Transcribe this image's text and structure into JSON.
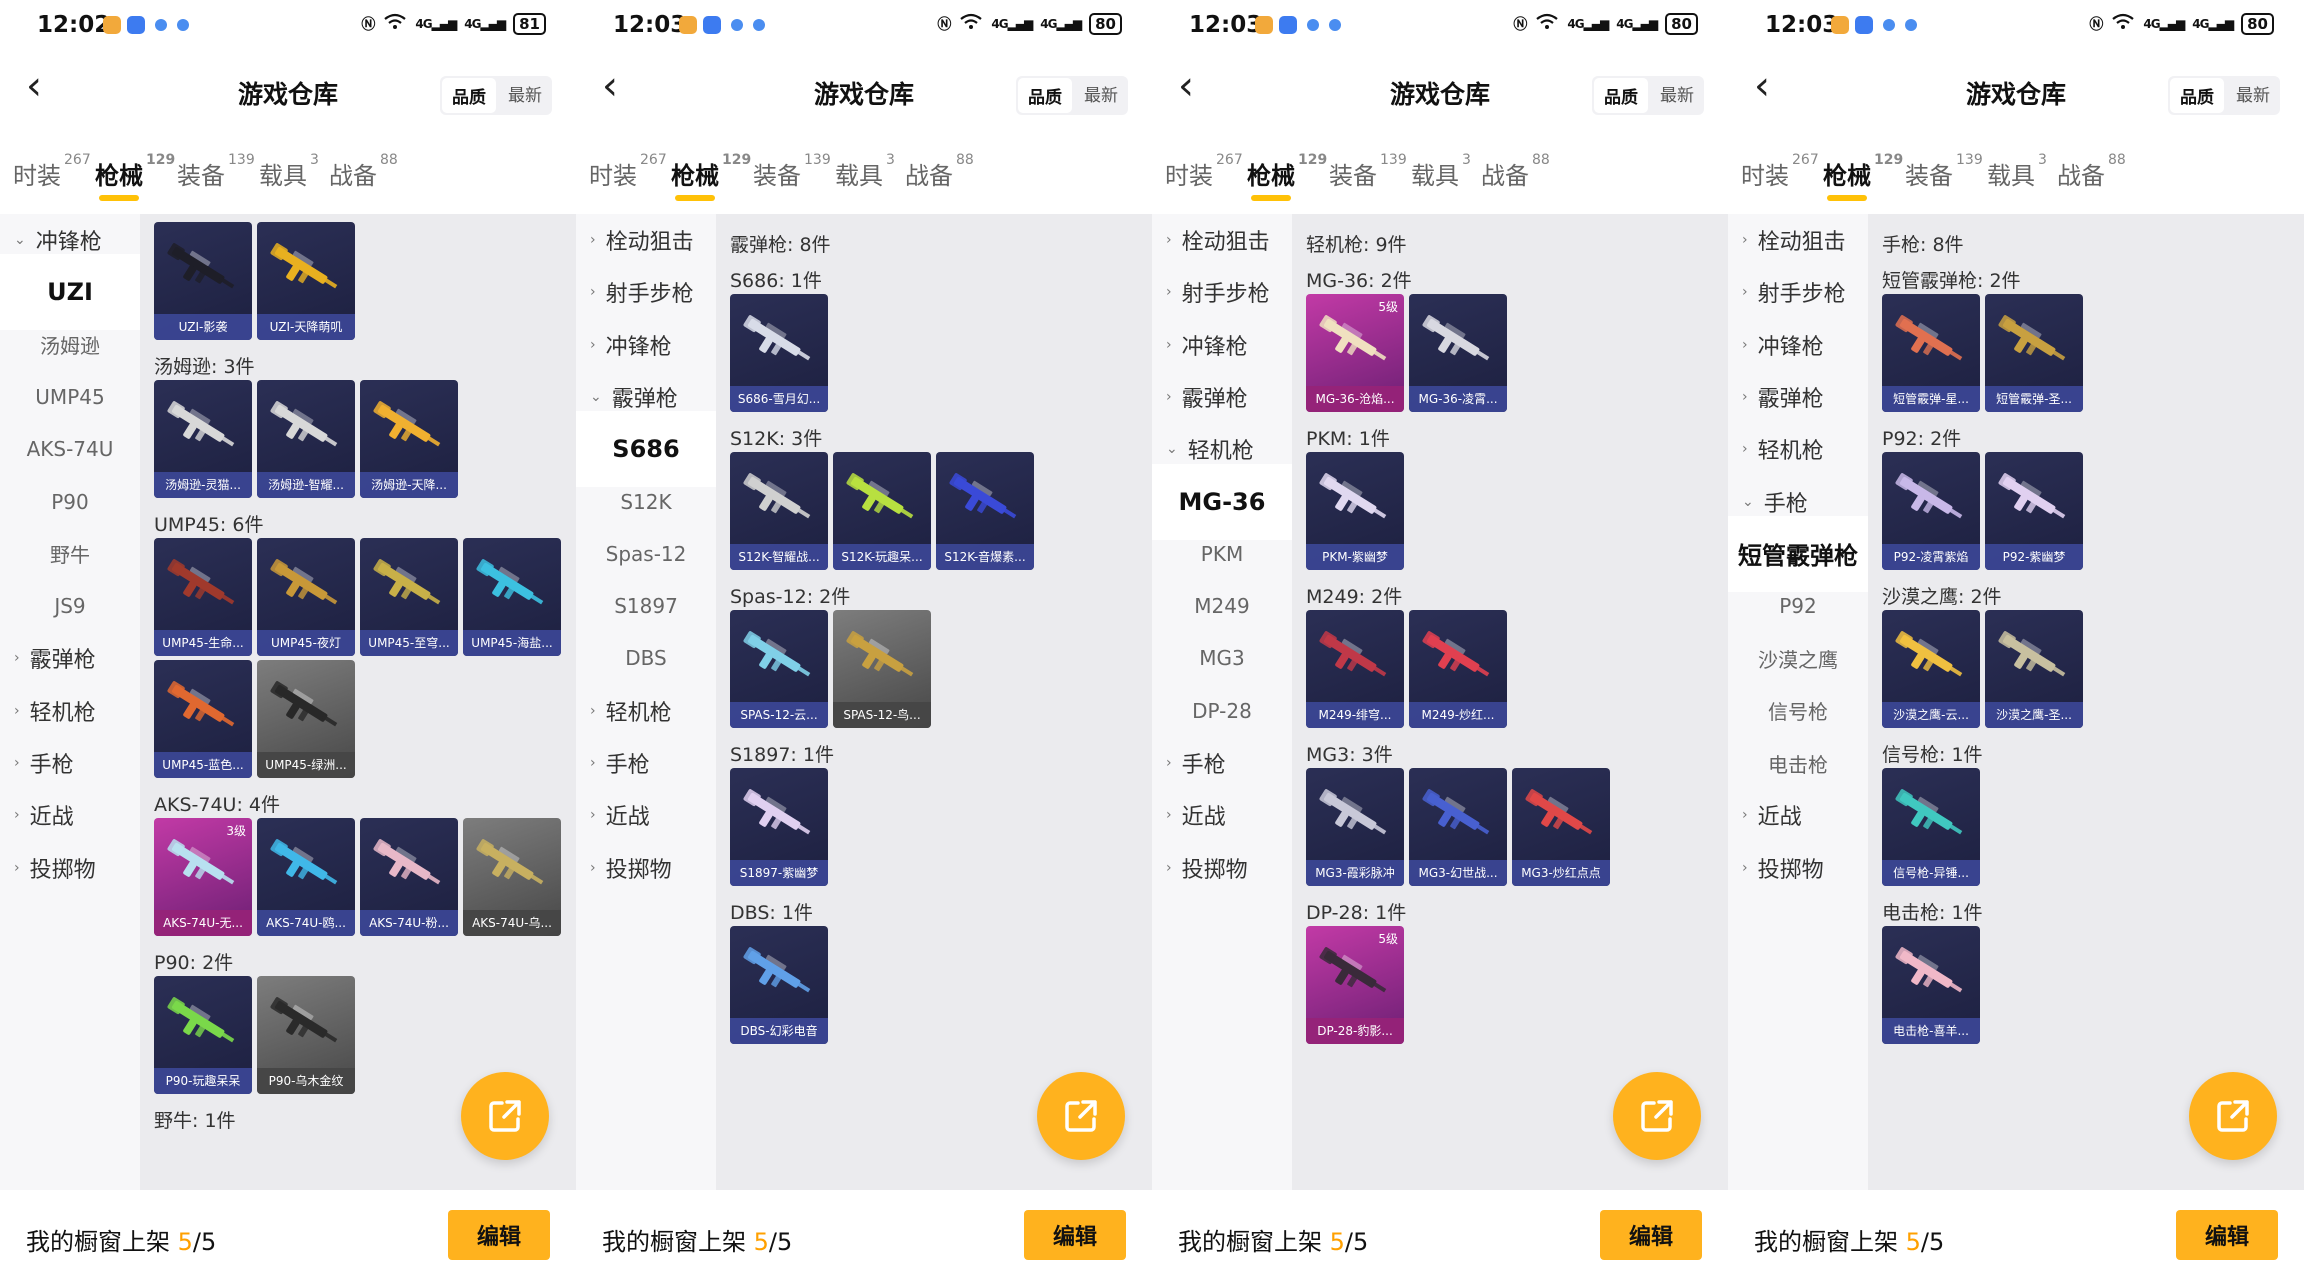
{
  "colors": {
    "accent": "#ffb21e",
    "card_default": "#2b2f55",
    "card_pink": "#c23aa6",
    "card_gray": "#6a6a6a",
    "sidebar_bg": "#f7f7f9",
    "content_bg": "#ebebee"
  },
  "common": {
    "title": "游戏仓库",
    "sort_quality": "品质",
    "sort_latest": "最新",
    "tabs": [
      {
        "label": "时装",
        "count": "267"
      },
      {
        "label": "枪械",
        "count": "129"
      },
      {
        "label": "装备",
        "count": "139"
      },
      {
        "label": "载具",
        "count": "3"
      },
      {
        "label": "战备",
        "count": "88"
      }
    ],
    "showcase_label": "我的橱窗上架",
    "showcase_count": "5",
    "showcase_total": "/5",
    "edit_label": "编辑",
    "icons": {
      "back": "chevron-left-icon",
      "fab": "share-external-icon",
      "group_open": "chevron-down-icon",
      "group_closed": "chevron-right-icon"
    }
  },
  "panels": [
    {
      "time": "12:02",
      "battery": "81",
      "sidebar": [
        {
          "type": "group",
          "label": "冲锋枪",
          "expanded": true
        },
        {
          "type": "sub",
          "label": "UZI",
          "selected": true
        },
        {
          "type": "sub",
          "label": "汤姆逊"
        },
        {
          "type": "sub",
          "label": "UMP45"
        },
        {
          "type": "sub",
          "label": "AKS-74U"
        },
        {
          "type": "sub",
          "label": "P90"
        },
        {
          "type": "sub",
          "label": "野牛"
        },
        {
          "type": "sub",
          "label": "JS9"
        },
        {
          "type": "group",
          "label": "霰弹枪"
        },
        {
          "type": "group",
          "label": "轻机枪"
        },
        {
          "type": "group",
          "label": "手枪"
        },
        {
          "type": "group",
          "label": "近战"
        },
        {
          "type": "group",
          "label": "投掷物"
        }
      ],
      "content": [
        {
          "type": "cards",
          "items": [
            {
              "name": "UZI-影袭",
              "color": "#1e1e28"
            },
            {
              "name": "UZI-天降萌叽",
              "color": "#e8b020"
            }
          ]
        },
        {
          "type": "label",
          "text": "汤姆逊: 3件"
        },
        {
          "type": "cards",
          "items": [
            {
              "name": "汤姆逊-灵猫...",
              "color": "#d8d8d8"
            },
            {
              "name": "汤姆逊-智耀...",
              "color": "#d8d8d8"
            },
            {
              "name": "汤姆逊-天降...",
              "color": "#f0b030"
            }
          ]
        },
        {
          "type": "label",
          "text": "UMP45: 6件"
        },
        {
          "type": "cards",
          "items": [
            {
              "name": "UMP45-生命...",
              "color": "#a0392c"
            },
            {
              "name": "UMP45-夜灯",
              "color": "#c89838"
            },
            {
              "name": "UMP45-至穹...",
              "color": "#c8b048"
            },
            {
              "name": "UMP45-海盐...",
              "color": "#3cc0e0"
            }
          ]
        },
        {
          "type": "cards",
          "items": [
            {
              "name": "UMP45-蓝色...",
              "color": "#e06830"
            },
            {
              "name": "UMP45-绿洲...",
              "color": "#282828",
              "style": "gray"
            }
          ]
        },
        {
          "type": "label",
          "text": "AKS-74U: 4件"
        },
        {
          "type": "cards",
          "items": [
            {
              "name": "AKS-74U-无...",
              "color": "#b8e0f0",
              "style": "pink",
              "level": "3级"
            },
            {
              "name": "AKS-74U-鸥...",
              "color": "#40b8e8"
            },
            {
              "name": "AKS-74U-粉...",
              "color": "#e8b8c8"
            },
            {
              "name": "AKS-74U-乌...",
              "color": "#c8b060",
              "style": "gray"
            }
          ]
        },
        {
          "type": "label",
          "text": "P90: 2件"
        },
        {
          "type": "cards",
          "items": [
            {
              "name": "P90-玩趣呆呆",
              "color": "#7ad84a"
            },
            {
              "name": "P90-乌木金纹",
              "color": "#2a2a2a",
              "style": "gray"
            }
          ]
        },
        {
          "type": "label",
          "text": "野牛: 1件"
        }
      ]
    },
    {
      "time": "12:03",
      "battery": "80",
      "sidebar": [
        {
          "type": "group",
          "label": "栓动狙击"
        },
        {
          "type": "group",
          "label": "射手步枪"
        },
        {
          "type": "group",
          "label": "冲锋枪"
        },
        {
          "type": "group",
          "label": "霰弹枪",
          "expanded": true
        },
        {
          "type": "sub",
          "label": "S686",
          "selected": true
        },
        {
          "type": "sub",
          "label": "S12K"
        },
        {
          "type": "sub",
          "label": "Spas-12"
        },
        {
          "type": "sub",
          "label": "S1897"
        },
        {
          "type": "sub",
          "label": "DBS"
        },
        {
          "type": "group",
          "label": "轻机枪"
        },
        {
          "type": "group",
          "label": "手枪"
        },
        {
          "type": "group",
          "label": "近战"
        },
        {
          "type": "group",
          "label": "投掷物"
        }
      ],
      "content": [
        {
          "type": "label",
          "text": "霰弹枪: 8件"
        },
        {
          "type": "label",
          "text": "S686: 1件"
        },
        {
          "type": "cards",
          "items": [
            {
              "name": "S686-雪月幻...",
              "color": "#d8dce8"
            }
          ]
        },
        {
          "type": "label",
          "text": "S12K: 3件"
        },
        {
          "type": "cards",
          "items": [
            {
              "name": "S12K-智耀战...",
              "color": "#d0d0d0"
            },
            {
              "name": "S12K-玩趣呆...",
              "color": "#b8e040"
            },
            {
              "name": "S12K-音爆素...",
              "color": "#3a4ad8"
            }
          ]
        },
        {
          "type": "label",
          "text": "Spas-12: 2件"
        },
        {
          "type": "cards",
          "items": [
            {
              "name": "SPAS-12-云...",
              "color": "#80d0e8"
            },
            {
              "name": "SPAS-12-鸟...",
              "color": "#c8a040",
              "style": "gray"
            }
          ]
        },
        {
          "type": "label",
          "text": "S1897: 1件"
        },
        {
          "type": "cards",
          "items": [
            {
              "name": "S1897-紫幽梦",
              "color": "#e0d0f0"
            }
          ]
        },
        {
          "type": "label",
          "text": "DBS: 1件"
        },
        {
          "type": "cards",
          "items": [
            {
              "name": "DBS-幻彩电音",
              "color": "#60a0e8"
            }
          ]
        }
      ]
    },
    {
      "time": "12:03",
      "battery": "80",
      "sidebar": [
        {
          "type": "group",
          "label": "栓动狙击"
        },
        {
          "type": "group",
          "label": "射手步枪"
        },
        {
          "type": "group",
          "label": "冲锋枪"
        },
        {
          "type": "group",
          "label": "霰弹枪"
        },
        {
          "type": "group",
          "label": "轻机枪",
          "expanded": true
        },
        {
          "type": "sub",
          "label": "MG-36",
          "selected": true
        },
        {
          "type": "sub",
          "label": "PKM"
        },
        {
          "type": "sub",
          "label": "M249"
        },
        {
          "type": "sub",
          "label": "MG3"
        },
        {
          "type": "sub",
          "label": "DP-28"
        },
        {
          "type": "group",
          "label": "手枪"
        },
        {
          "type": "group",
          "label": "近战"
        },
        {
          "type": "group",
          "label": "投掷物"
        }
      ],
      "content": [
        {
          "type": "label",
          "text": "轻机枪: 9件"
        },
        {
          "type": "label",
          "text": "MG-36: 2件"
        },
        {
          "type": "cards",
          "items": [
            {
              "name": "MG-36-沧焰...",
              "color": "#f0e0c0",
              "style": "pink",
              "level": "5级"
            },
            {
              "name": "MG-36-凌霄...",
              "color": "#d8d8e0"
            }
          ]
        },
        {
          "type": "label",
          "text": "PKM: 1件"
        },
        {
          "type": "cards",
          "items": [
            {
              "name": "PKM-紫幽梦",
              "color": "#e0d8f0"
            }
          ]
        },
        {
          "type": "label",
          "text": "M249: 2件"
        },
        {
          "type": "cards",
          "items": [
            {
              "name": "M249-绯穹...",
              "color": "#c03848"
            },
            {
              "name": "M249-炒红...",
              "color": "#e04050"
            }
          ]
        },
        {
          "type": "label",
          "text": "MG3: 3件"
        },
        {
          "type": "cards",
          "items": [
            {
              "name": "MG3-霞彩脉冲",
              "color": "#c8c8d8"
            },
            {
              "name": "MG3-幻世战...",
              "color": "#4860d0"
            },
            {
              "name": "MG3-炒红点点",
              "color": "#e04848"
            }
          ]
        },
        {
          "type": "label",
          "text": "DP-28: 1件"
        },
        {
          "type": "cards",
          "items": [
            {
              "name": "DP-28-豹影...",
              "color": "#3a2a3a",
              "style": "pink",
              "level": "5级"
            }
          ]
        }
      ]
    },
    {
      "time": "12:03",
      "battery": "80",
      "sidebar": [
        {
          "type": "group",
          "label": "栓动狙击"
        },
        {
          "type": "group",
          "label": "射手步枪"
        },
        {
          "type": "group",
          "label": "冲锋枪"
        },
        {
          "type": "group",
          "label": "霰弹枪"
        },
        {
          "type": "group",
          "label": "轻机枪"
        },
        {
          "type": "group",
          "label": "手枪",
          "expanded": true
        },
        {
          "type": "sub",
          "label": "短管霰弹枪",
          "selected": true
        },
        {
          "type": "sub",
          "label": "P92"
        },
        {
          "type": "sub",
          "label": "沙漠之鹰"
        },
        {
          "type": "sub",
          "label": "信号枪"
        },
        {
          "type": "sub",
          "label": "电击枪"
        },
        {
          "type": "group",
          "label": "近战"
        },
        {
          "type": "group",
          "label": "投掷物"
        }
      ],
      "content": [
        {
          "type": "label",
          "text": "手枪: 8件"
        },
        {
          "type": "label",
          "text": "短管霰弹枪: 2件"
        },
        {
          "type": "cards",
          "items": [
            {
              "name": "短管霰弹-星...",
              "color": "#e07050"
            },
            {
              "name": "短管霰弹-圣...",
              "color": "#c8a040"
            }
          ]
        },
        {
          "type": "label",
          "text": "P92: 2件"
        },
        {
          "type": "cards",
          "items": [
            {
              "name": "P92-凌霄紫焰",
              "color": "#c8b8e8"
            },
            {
              "name": "P92-紫幽梦",
              "color": "#e0d0f0"
            }
          ]
        },
        {
          "type": "label",
          "text": "沙漠之鹰: 2件"
        },
        {
          "type": "cards",
          "items": [
            {
              "name": "沙漠之鹰-云...",
              "color": "#f0c040"
            },
            {
              "name": "沙漠之鹰-圣...",
              "color": "#c8c0a0"
            }
          ]
        },
        {
          "type": "label",
          "text": "信号枪: 1件"
        },
        {
          "type": "cards",
          "items": [
            {
              "name": "信号枪-异锤...",
              "color": "#40c8c0"
            }
          ]
        },
        {
          "type": "label",
          "text": "电击枪: 1件"
        },
        {
          "type": "cards",
          "items": [
            {
              "name": "电击枪-喜羊...",
              "color": "#f0b8c8"
            }
          ]
        }
      ]
    }
  ]
}
